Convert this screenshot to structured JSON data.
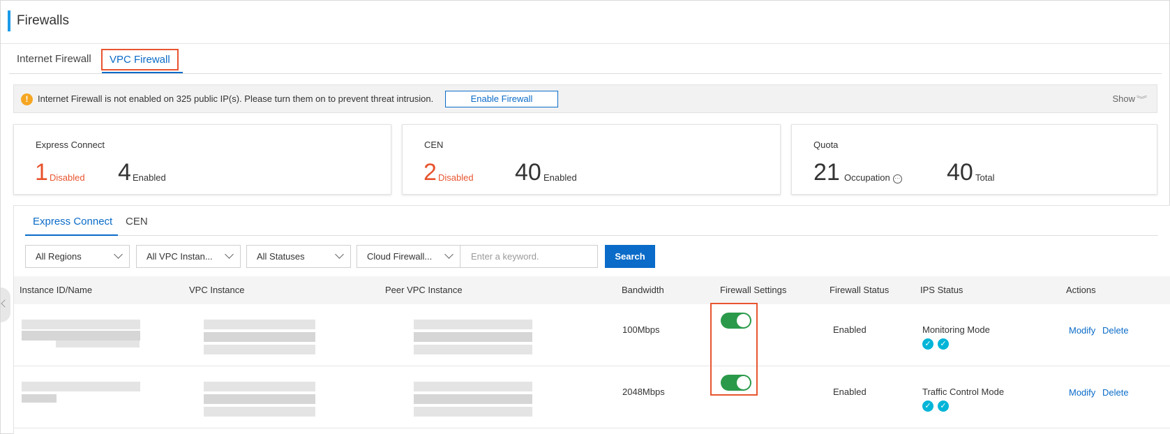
{
  "header": {
    "title": "Firewalls"
  },
  "top_tabs": [
    {
      "label": "Internet Firewall"
    },
    {
      "label": "VPC Firewall",
      "active": true
    }
  ],
  "notice": {
    "message": "Internet Firewall is not enabled on 325 public IP(s). Please turn them on to prevent threat intrusion.",
    "button": "Enable Firewall",
    "show": "Show"
  },
  "cards": {
    "express": {
      "label": "Express Connect",
      "disabled_num": "1",
      "disabled_label": "Disabled",
      "enabled_num": "4",
      "enabled_label": "Enabled"
    },
    "cen": {
      "label": "CEN",
      "disabled_num": "2",
      "disabled_label": "Disabled",
      "enabled_num": "40",
      "enabled_label": "Enabled"
    },
    "quota": {
      "label": "Quota",
      "occupation_num": "21",
      "occupation_label": "Occupation",
      "total_num": "40",
      "total_label": "Total"
    }
  },
  "inner_tabs": [
    {
      "label": "Express Connect",
      "active": true
    },
    {
      "label": "CEN"
    }
  ],
  "filters": {
    "region": "All Regions",
    "vpc_instance": "All VPC Instan...",
    "status": "All Statuses",
    "cloud_firewall": "Cloud Firewall...",
    "keyword_placeholder": "Enter a keyword.",
    "search": "Search"
  },
  "table": {
    "columns": [
      "Instance ID/Name",
      "VPC Instance",
      "Peer VPC Instance",
      "Bandwidth",
      "Firewall Settings",
      "Firewall Status",
      "IPS Status",
      "Actions"
    ],
    "rows": [
      {
        "bandwidth": "100Mbps",
        "firewall_on": true,
        "status": "Enabled",
        "ips": "Monitoring Mode",
        "modify": "Modify",
        "delete": "Delete"
      },
      {
        "bandwidth": "2048Mbps",
        "firewall_on": true,
        "status": "Enabled",
        "ips": "Traffic Control Mode",
        "modify": "Modify",
        "delete": "Delete"
      }
    ]
  },
  "colors": {
    "accent": "#0a6bc8",
    "danger": "#e8542f",
    "toggle_on": "#2a9a4a",
    "ips_check": "#00b5d8"
  }
}
